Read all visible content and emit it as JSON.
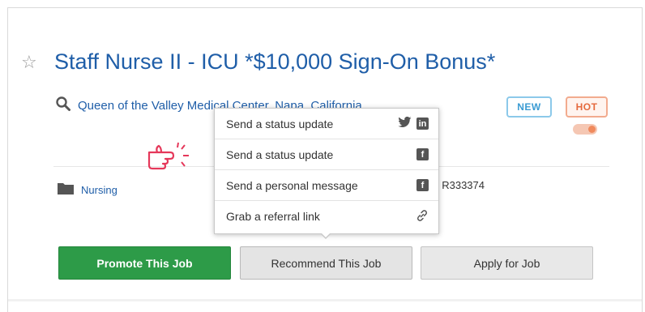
{
  "job": {
    "title": "Staff Nurse II - ICU *$10,000 Sign-On Bonus*",
    "location": "Queen of the Valley Medical Center, Napa, California",
    "category": "Nursing",
    "req_id": "/ R333374"
  },
  "badges": {
    "new": "NEW",
    "hot": "HOT"
  },
  "share_menu": {
    "items": [
      {
        "label": "Send a status update",
        "icons": [
          "twitter-icon",
          "linkedin-icon"
        ]
      },
      {
        "label": "Send a status update",
        "icons": [
          "facebook-icon"
        ]
      },
      {
        "label": "Send a personal message",
        "icons": [
          "facebook-icon"
        ]
      },
      {
        "label": "Grab a referral link",
        "icons": [
          "link-icon"
        ]
      }
    ]
  },
  "actions": {
    "promote": "Promote This Job",
    "recommend": "Recommend This Job",
    "apply": "Apply for Job"
  },
  "colors": {
    "link": "#1f5ea8",
    "promote_bg": "#2d9b48",
    "new_badge": "#3a9bd3",
    "hot_badge": "#e5693d",
    "pointer_hand": "#e5385a"
  }
}
